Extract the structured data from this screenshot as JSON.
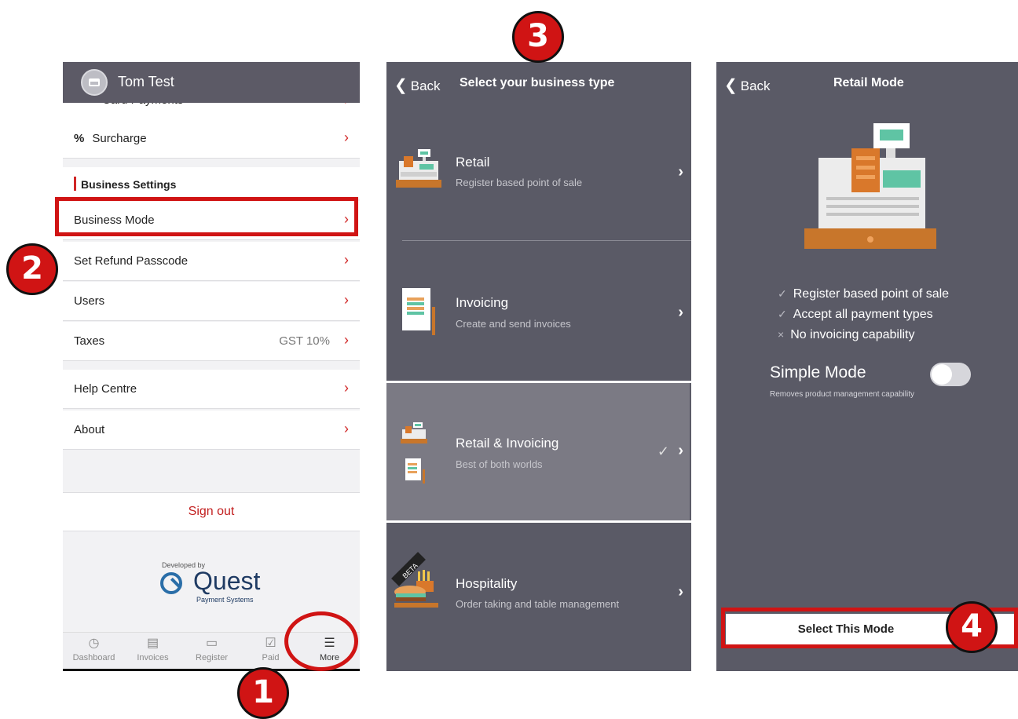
{
  "screen1": {
    "username": "Tom Test",
    "cut_row_label": "Card Payments",
    "surcharge_label": "Surcharge",
    "surcharge_icon": "%",
    "section_title": "Business Settings",
    "rows": [
      {
        "label": "Business Mode",
        "value": ""
      },
      {
        "label": "Set Refund Passcode",
        "value": ""
      },
      {
        "label": "Users",
        "value": ""
      },
      {
        "label": "Taxes",
        "value": "GST 10%"
      }
    ],
    "rows2": [
      {
        "label": "Help Centre"
      },
      {
        "label": "About"
      }
    ],
    "sign_out": "Sign out",
    "developed_by": "Developed by",
    "brand": "Quest",
    "brand_sub": "Payment Systems",
    "tabs": [
      {
        "label": "Dashboard",
        "icon": "◷"
      },
      {
        "label": "Invoices",
        "icon": "▤"
      },
      {
        "label": "Register",
        "icon": "▭"
      },
      {
        "label": "Paid",
        "icon": "☑"
      },
      {
        "label": "More",
        "icon": "☰"
      }
    ]
  },
  "screen2": {
    "back": "Back",
    "title": "Select your business type",
    "types": [
      {
        "title": "Retail",
        "subtitle": "Register based point of sale"
      },
      {
        "title": "Invoicing",
        "subtitle": "Create and send invoices"
      },
      {
        "title": "Retail & Invoicing",
        "subtitle": "Best of both worlds"
      },
      {
        "title": "Hospitality",
        "subtitle": "Order taking and table management"
      }
    ],
    "beta": "BETA"
  },
  "screen3": {
    "back": "Back",
    "title": "Retail Mode",
    "features": [
      {
        "mark": "✓",
        "text": "Register based point of sale"
      },
      {
        "mark": "✓",
        "text": "Accept all payment types"
      },
      {
        "mark": "×",
        "text": "No invoicing capability"
      }
    ],
    "simple_mode": "Simple Mode",
    "simple_mode_sub": "Removes product management capability",
    "simple_mode_on": false,
    "select_button": "Select This Mode"
  },
  "annotations": [
    "1",
    "2",
    "3",
    "4"
  ],
  "colors": {
    "accent": "#d02626",
    "nav_bg": "#5a5a66",
    "annotation": "#d01414"
  }
}
